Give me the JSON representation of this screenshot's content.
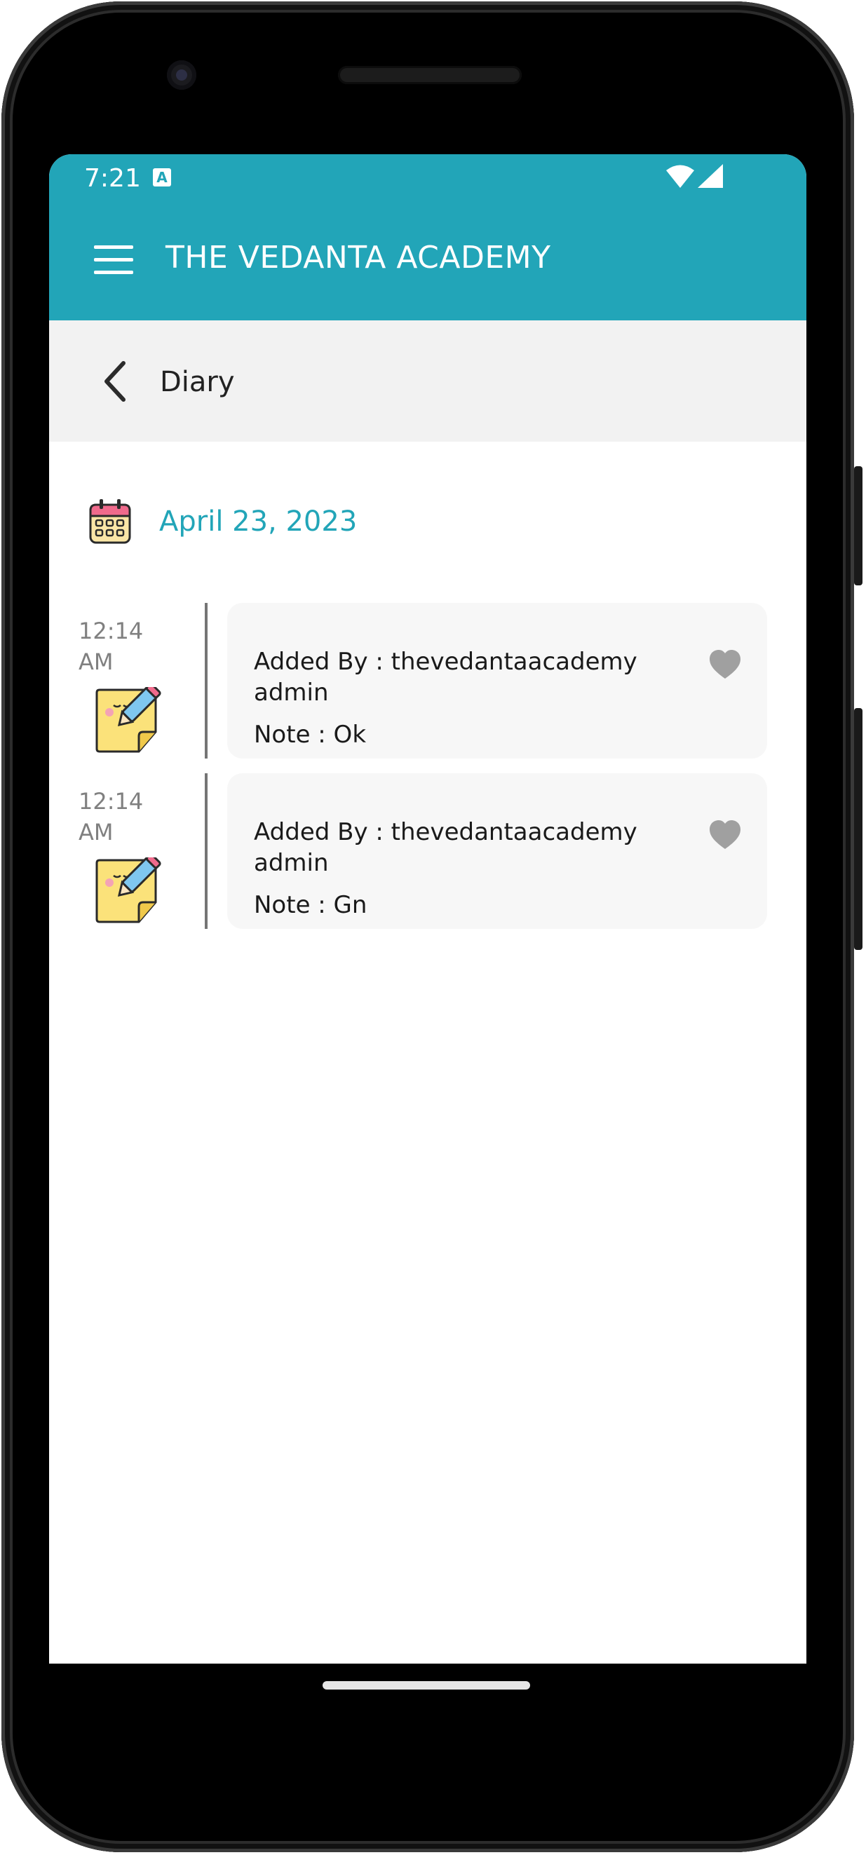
{
  "status_bar": {
    "time": "7:21",
    "notification_icon": "A"
  },
  "header": {
    "title": "THE VEDANTA ACADEMY",
    "menu_icon": "hamburger-menu",
    "background_color": "#22a5b8"
  },
  "sub_header": {
    "title": "Diary",
    "back_icon": "chevron-left"
  },
  "date": "April 23, 2023",
  "entries": [
    {
      "time": "12:14 AM",
      "added_by": "Added By : thevedantaacademy admin",
      "note": "Note : Ok",
      "icon": "note-pencil"
    },
    {
      "time": "12:14 AM",
      "added_by": "Added By : thevedantaacademy admin",
      "note": "Note : Gn",
      "icon": "note-pencil"
    }
  ],
  "colors": {
    "accent": "#22a5b8",
    "heart": "#a0a0a0"
  }
}
